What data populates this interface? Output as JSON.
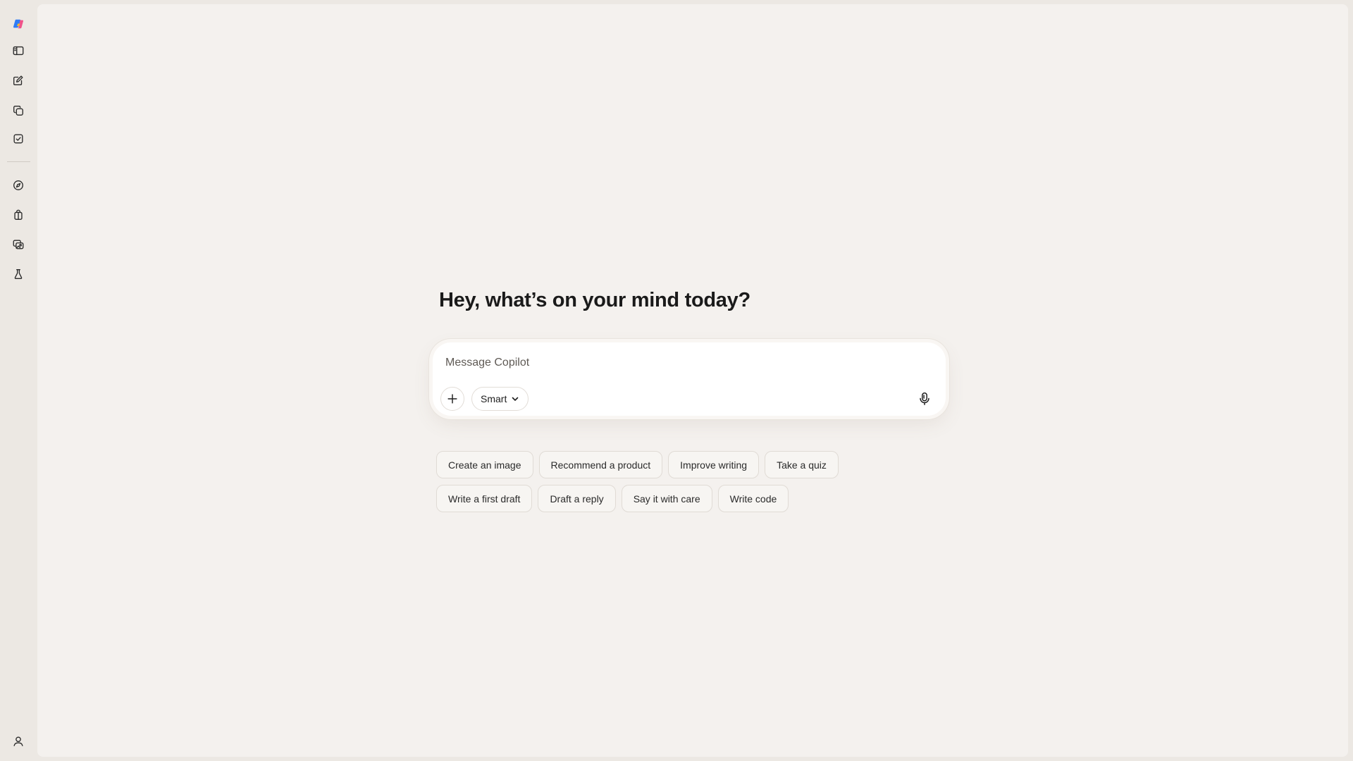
{
  "app": {
    "name": "Copilot",
    "colors": {
      "rail_background": "#ece8e3",
      "main_background": "#f4f1ee",
      "composer_background": "#ffffff",
      "text": "#1a1a1a"
    }
  },
  "rail": {
    "top_items": [
      {
        "name": "copilot-logo",
        "icon": "copilot-logo-icon"
      },
      {
        "name": "toggle-sidebar",
        "icon": "sidebar-panel-icon"
      },
      {
        "name": "new-chat",
        "icon": "compose-icon"
      },
      {
        "name": "library",
        "icon": "stacked-pages-icon"
      },
      {
        "name": "tasks",
        "icon": "checkbox-icon"
      }
    ],
    "lower_items": [
      {
        "name": "discover",
        "icon": "compass-icon"
      },
      {
        "name": "shopping",
        "icon": "shopping-bag-icon"
      },
      {
        "name": "imagine",
        "icon": "image-gallery-icon"
      },
      {
        "name": "labs",
        "icon": "flask-icon"
      }
    ],
    "bottom_items": [
      {
        "name": "profile",
        "icon": "user-icon"
      }
    ]
  },
  "main": {
    "greeting": "Hey, what’s on your mind today?",
    "composer": {
      "placeholder": "Message Copilot",
      "value": "",
      "mode_label": "Smart",
      "add_icon": "plus-icon",
      "mic_icon": "microphone-icon"
    },
    "suggestions": {
      "row1": [
        "Create an image",
        "Recommend a product",
        "Improve writing",
        "Take a quiz"
      ],
      "row2": [
        "Write a first draft",
        "Draft a reply",
        "Say it with care",
        "Write code"
      ]
    }
  }
}
